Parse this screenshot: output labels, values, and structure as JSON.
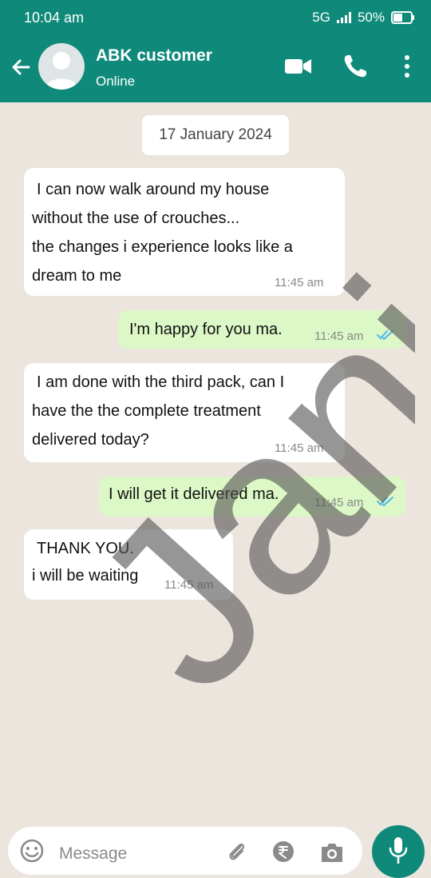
{
  "status_bar": {
    "time": "10:04 am",
    "network": "5G",
    "battery": "50%"
  },
  "header": {
    "contact_name": "ABK customer",
    "contact_status": "Online",
    "icons": [
      "back-arrow-icon",
      "avatar",
      "video-call-icon",
      "phone-call-icon",
      "more-options-icon"
    ]
  },
  "chat": {
    "date": "17 January 2024",
    "messages": [
      {
        "direction": "incoming",
        "lines": [
          "I can now walk around my house",
          "without the use of crouches...",
          "the changes i experience looks like a",
          "dream to me"
        ],
        "time": "11:45 am"
      },
      {
        "direction": "outgoing",
        "lines": [
          "I'm happy for you ma."
        ],
        "time": "11:45 am",
        "status": "read"
      },
      {
        "direction": "incoming",
        "lines": [
          "I am done with the third pack, can I",
          "have the the complete treatment",
          "delivered today?"
        ],
        "time": "11:45 am"
      },
      {
        "direction": "outgoing",
        "lines": [
          "I will get it delivered ma."
        ],
        "time": "11:45 am",
        "status": "read"
      },
      {
        "direction": "incoming",
        "lines": [
          "THANK YOU.",
          "i will be waiting"
        ],
        "time": "11:45 am"
      }
    ],
    "watermark": "Janis"
  },
  "input": {
    "placeholder": "Message",
    "icons": [
      "emoji-icon",
      "attach-icon",
      "rupee-icon",
      "camera-icon",
      "mic-icon"
    ]
  },
  "colors": {
    "header": "#0f8a7a",
    "chat_background": "#ece5dd",
    "outgoing_bubble": "#dcf8c6",
    "incoming_bubble": "#ffffff",
    "read_ticks": "#4fb6ec"
  }
}
